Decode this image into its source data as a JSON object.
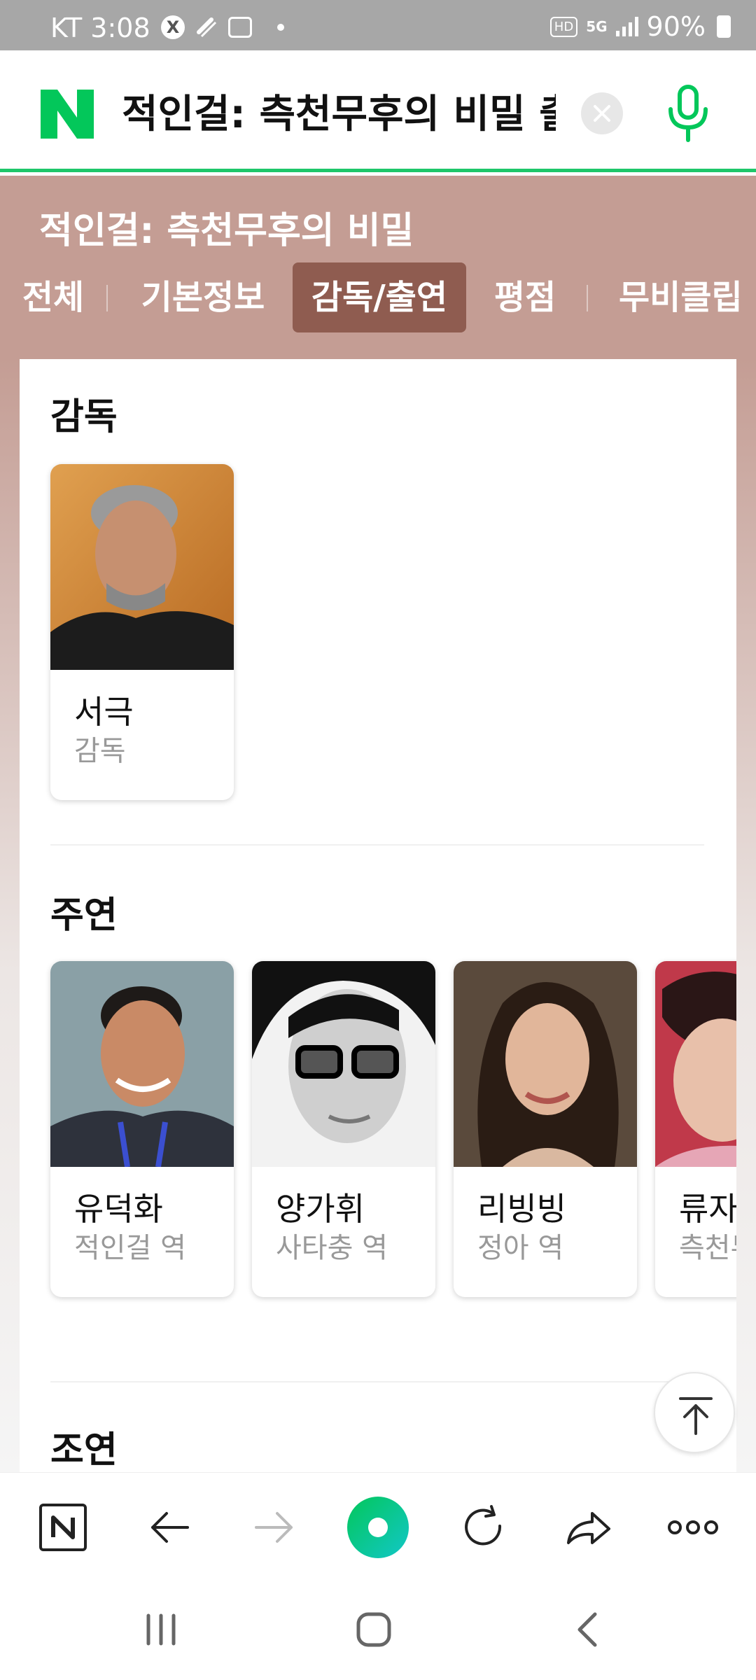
{
  "status_bar": {
    "carrier": "KT",
    "time": "3:08",
    "battery": "90%",
    "network": "5G",
    "hd_label": "HD"
  },
  "search": {
    "query": "적인걸: 측천무후의 비밀 출"
  },
  "movie": {
    "title": "적인걸: 측천무후의 비밀",
    "tabs": [
      {
        "label": "전체",
        "active": false
      },
      {
        "label": "기본정보",
        "active": false
      },
      {
        "label": "감독/출연",
        "active": true
      },
      {
        "label": "평점",
        "active": false
      },
      {
        "label": "무비클립",
        "active": false
      }
    ]
  },
  "sections": {
    "director": {
      "title": "감독",
      "people": [
        {
          "name": "서극",
          "role": "감독"
        }
      ]
    },
    "lead": {
      "title": "주연",
      "people": [
        {
          "name": "유덕화",
          "role": "적인걸 역"
        },
        {
          "name": "양가휘",
          "role": "사타충 역"
        },
        {
          "name": "리빙빙",
          "role": "정아 역"
        },
        {
          "name": "류자링",
          "role": "측천무후 역"
        }
      ]
    },
    "supporting": {
      "title": "조연"
    }
  },
  "colors": {
    "brand_green": "#03c75a",
    "band": "#c49d94",
    "active_tab": "#8f5c50"
  },
  "icons": {
    "logo": "naver-n-logo",
    "clear": "close-icon",
    "mic": "microphone-icon",
    "top": "arrow-up-icon",
    "toolbar": [
      "naver-home-icon",
      "back-arrow-icon",
      "forward-arrow-icon",
      "green-dot-icon",
      "refresh-icon",
      "share-icon",
      "more-icon"
    ],
    "nav": [
      "recent-apps-icon",
      "home-icon",
      "back-icon"
    ]
  }
}
